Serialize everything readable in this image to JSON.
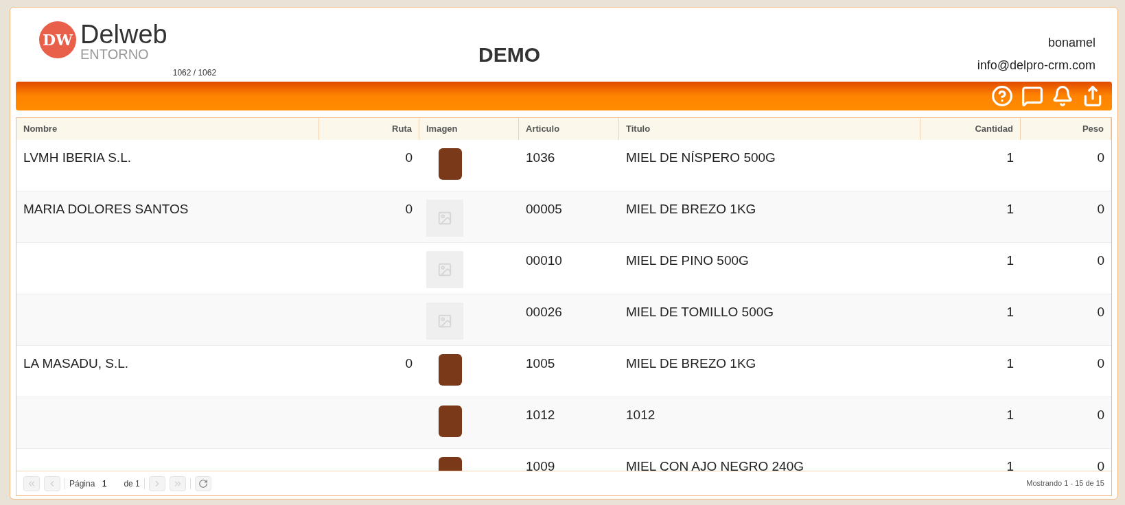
{
  "header": {
    "logo_mark": "DW",
    "logo_name": "Delweb",
    "logo_sub": "ENTORNO",
    "counter": "1062 / 1062",
    "title": "DEMO",
    "user": "bonamel",
    "email": "info@delpro-crm.com"
  },
  "toolbar": {
    "icons": [
      {
        "kind": "help"
      },
      {
        "kind": "chat"
      },
      {
        "kind": "bell"
      },
      {
        "kind": "share"
      }
    ]
  },
  "table": {
    "columns": [
      "Nombre",
      "Ruta",
      "Imagen",
      "Articulo",
      "Titulo",
      "Cantidad",
      "Peso"
    ],
    "rows": [
      {
        "nombre": "LVMH IBERIA S.L.",
        "ruta": "0",
        "image": {
          "kind": "photo"
        },
        "articulo": "1036",
        "titulo": "MIEL DE NÍSPERO 500G",
        "cantidad": "1",
        "peso": "0"
      },
      {
        "nombre": "MARIA DOLORES SANTOS",
        "ruta": "0",
        "image": {
          "kind": "none"
        },
        "articulo": "00005",
        "titulo": "MIEL DE BREZO 1KG",
        "cantidad": "1",
        "peso": "0"
      },
      {
        "image": {
          "kind": "none"
        },
        "articulo": "00010",
        "titulo": "MIEL DE PINO 500G",
        "cantidad": "1",
        "peso": "0"
      },
      {
        "image": {
          "kind": "none"
        },
        "articulo": "00026",
        "titulo": "MIEL DE TOMILLO 500G",
        "cantidad": "1",
        "peso": "0"
      },
      {
        "nombre": "LA MASADU, S.L.",
        "ruta": "0",
        "image": {
          "kind": "photo"
        },
        "articulo": "1005",
        "titulo": "MIEL DE BREZO 1KG",
        "cantidad": "1",
        "peso": "0"
      },
      {
        "image": {
          "kind": "photo"
        },
        "articulo": "1012",
        "titulo": "1012",
        "cantidad": "1",
        "peso": "0"
      },
      {
        "image": {
          "kind": "photo"
        },
        "articulo": "1009",
        "titulo": "MIEL CON AJO NEGRO 240G",
        "cantidad": "1",
        "peso": "0"
      }
    ]
  },
  "pager": {
    "first": {
      "disabled": true
    },
    "prev": {
      "disabled": true
    },
    "page_label": "Página",
    "page_value": "1",
    "of_label": "de 1",
    "next": {
      "disabled": true
    },
    "last": {
      "disabled": true
    },
    "summary": "Mostrando 1 - 15 de 15"
  }
}
